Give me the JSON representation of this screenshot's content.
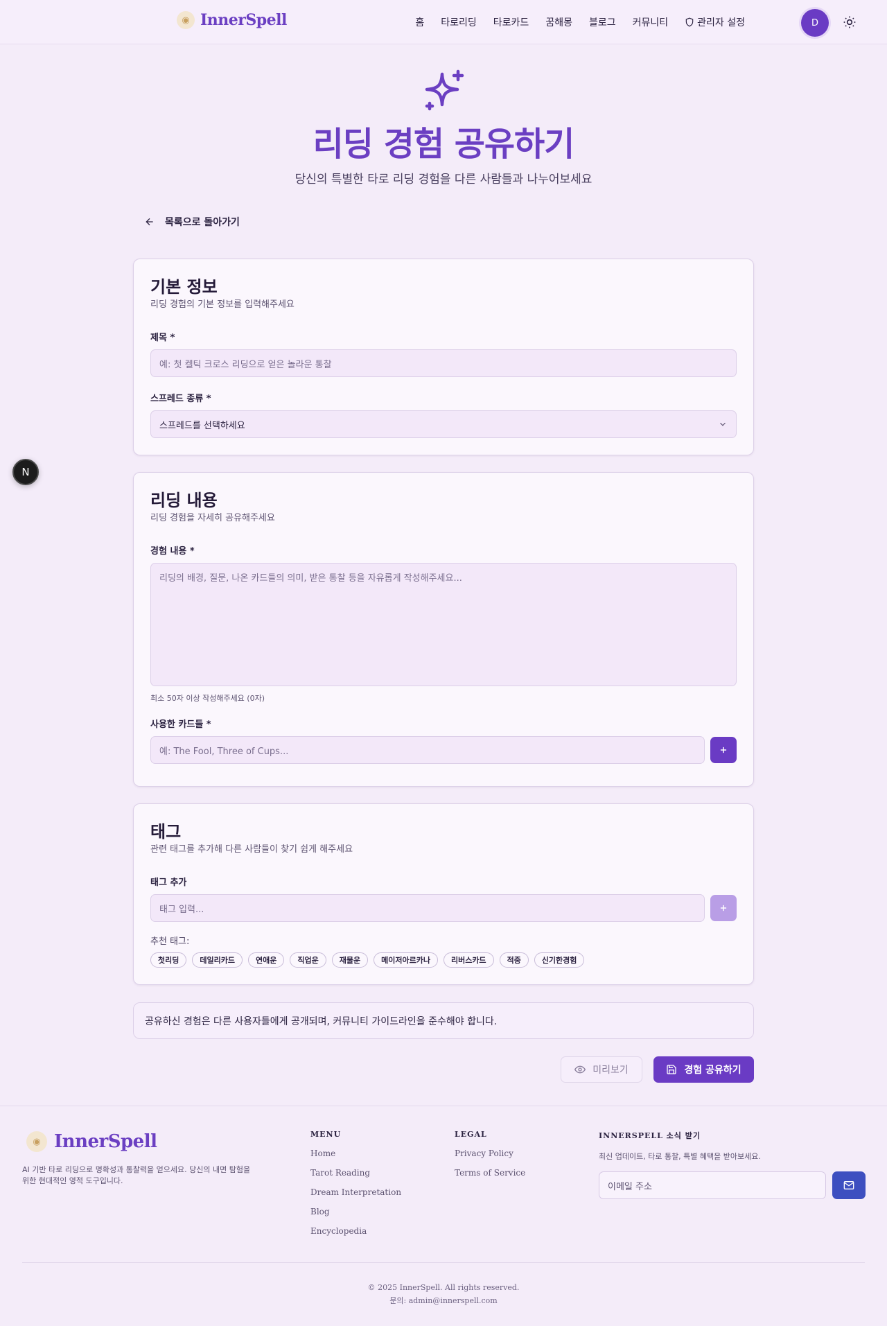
{
  "header": {
    "logo_text": "InnerSpell",
    "nav": [
      "홈",
      "타로리딩",
      "타로카드",
      "꿈해몽",
      "블로그",
      "커뮤니티"
    ],
    "admin_label": "관리자 설정",
    "avatar_initial": "D"
  },
  "hero": {
    "title": "리딩 경험 공유하기",
    "subtitle": "당신의 특별한 타로 리딩 경험을 다른 사람들과 나누어보세요"
  },
  "back_label": "목록으로 돌아가기",
  "basic": {
    "title": "기본 정보",
    "desc": "리딩 경험의 기본 정보를 입력해주세요",
    "title_label": "제목 *",
    "title_placeholder": "예: 첫 켈틱 크로스 리딩으로 얻은 놀라운 통찰",
    "spread_label": "스프레드 종류 *",
    "spread_value": "스프레드를 선택하세요"
  },
  "content": {
    "title": "리딩 내용",
    "desc": "리딩 경험을 자세히 공유해주세요",
    "body_label": "경험 내용 *",
    "body_placeholder": "리딩의 배경, 질문, 나온 카드들의 의미, 받은 통찰 등을 자유롭게 작성해주세요...",
    "hint": "최소 50자 이상 작성해주세요 (0자)",
    "cards_label": "사용한 카드들 *",
    "cards_placeholder": "예: The Fool, Three of Cups..."
  },
  "tags": {
    "title": "태그",
    "desc": "관련 태그를 추가해 다른 사람들이 찾기 쉽게 해주세요",
    "add_label": "태그 추가",
    "add_placeholder": "태그 입력...",
    "suggest_label": "추천 태그:",
    "suggested": [
      "첫리딩",
      "데일리카드",
      "연애운",
      "직업운",
      "재물운",
      "메이저아르카나",
      "리버스카드",
      "적중",
      "신기한경험"
    ]
  },
  "notice": "공유하신 경험은 다른 사용자들에게 공개되며, 커뮤니티 가이드라인을 준수해야 합니다.",
  "actions": {
    "preview": "미리보기",
    "submit": "경험 공유하기"
  },
  "floating_badge": "N",
  "footer": {
    "logo_text": "InnerSpell",
    "desc": "AI 기반 타로 리딩으로 명확성과 통찰력을 얻으세요. 당신의 내면 탐험을 위한 현대적인 영적 도구입니다.",
    "menu_title": "MENU",
    "menu": [
      "Home",
      "Tarot Reading",
      "Dream Interpretation",
      "Blog",
      "Encyclopedia"
    ],
    "legal_title": "LEGAL",
    "legal": [
      "Privacy Policy",
      "Terms of Service"
    ],
    "news_title": "INNERSPELL 소식 받기",
    "news_desc": "최신 업데이트, 타로 통찰, 특별 혜택을 받아보세요.",
    "email_placeholder": "이메일 주소",
    "copyright": "© 2025 InnerSpell. All rights reserved.",
    "contact": "문의: admin@innerspell.com"
  },
  "colors": {
    "accent": "#6a3bc4",
    "mail_button": "#3d4fc0"
  },
  "icons": [
    "sparkles-icon",
    "shield-icon",
    "sun-icon",
    "arrow-left-icon",
    "chevron-down-icon",
    "plus-icon",
    "eye-icon",
    "save-icon",
    "mail-icon"
  ]
}
